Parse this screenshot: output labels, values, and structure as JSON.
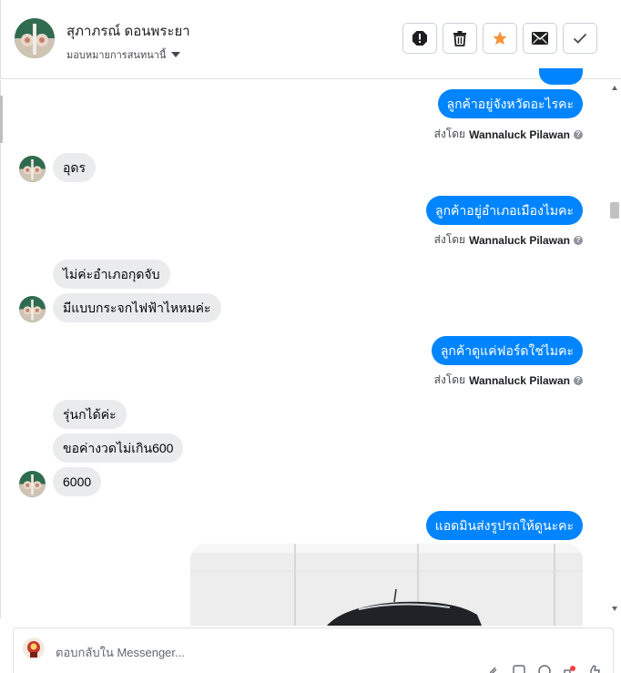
{
  "header": {
    "customer_name": "สุภาภรณ์ ดอนพระยา",
    "assign_label": "มอบหมายการสนทนานี้",
    "actions": [
      "spam-icon",
      "trash-icon",
      "star-icon",
      "mail-icon",
      "check-icon"
    ],
    "star_color": "#f7923b"
  },
  "thread": {
    "partial_top_bubble": "",
    "msg_out_1": "ลูกค้าอยู่จังหวัดอะไรคะ",
    "sent_by_1_prefix": "ส่งโดย",
    "sent_by_1_name": "Wannaluck Pilawan",
    "msg_in_1": "อุดร",
    "msg_out_2": "ลูกค้าอยู่อำเภอเมืองไมคะ",
    "sent_by_2_prefix": "ส่งโดย",
    "sent_by_2_name": "Wannaluck Pilawan",
    "msg_in_2": "ไม่ค่ะอำเภอกุดจับ",
    "msg_in_3": "มีแบบกระจกไฟฟ้าไหหมค่ะ",
    "msg_out_3": "ลูกค้าดูแค่ฟอร์ดใช่ไมคะ",
    "sent_by_3_prefix": "ส่งโดย",
    "sent_by_3_name": "Wannaluck Pilawan",
    "msg_in_4": "รุ่นกได้ค่ะ",
    "msg_in_5": "ขอค่างวดไม่เกิน600",
    "msg_in_6": "6000",
    "msg_out_4": "แอดมินส่งรูปรถให้ดูนะคะ",
    "help_glyph": "?"
  },
  "composer": {
    "placeholder": "ตอบกลับใน Messenger...",
    "icons": [
      "attach-icon",
      "sticker-icon",
      "emoji-icon",
      "gif-icon",
      "like-icon"
    ]
  },
  "colors": {
    "outgoing_bubble": "#0084ff",
    "incoming_bubble": "#eaebed",
    "accent": "#0084ff"
  }
}
